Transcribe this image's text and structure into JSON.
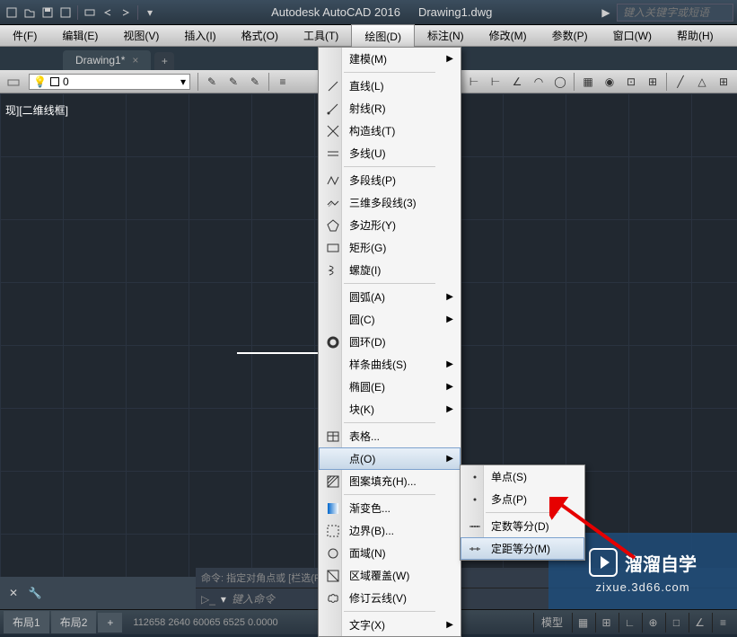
{
  "title": {
    "app": "Autodesk AutoCAD 2016",
    "file": "Drawing1.dwg"
  },
  "search": {
    "placeholder": "键入关键字或短语"
  },
  "menus": [
    "件(F)",
    "编辑(E)",
    "视图(V)",
    "插入(I)",
    "格式(O)",
    "工具(T)",
    "绘图(D)",
    "标注(N)",
    "修改(M)",
    "参数(P)",
    "窗口(W)",
    "帮助(H)"
  ],
  "active_menu_index": 6,
  "file_tab": {
    "name": "Drawing1*"
  },
  "layer": {
    "name": "0"
  },
  "canvas": {
    "label": "现][二维线框]"
  },
  "cmd": {
    "history": "命令: 指定对角点或 [栏选(F)/圈围(WP)/圈交(CP)]:",
    "prompt": "键入命令"
  },
  "layouts": [
    "布局1",
    "布局2"
  ],
  "coords": "112658 2640 60065 6525 0.0000",
  "status_label": "模型",
  "dropdown_items": [
    {
      "label": "建模(M)",
      "submenu": true
    },
    {
      "sep": true
    },
    {
      "label": "直线(L)"
    },
    {
      "label": "射线(R)"
    },
    {
      "label": "构造线(T)"
    },
    {
      "label": "多线(U)"
    },
    {
      "sep": true
    },
    {
      "label": "多段线(P)"
    },
    {
      "label": "三维多段线(3)"
    },
    {
      "label": "多边形(Y)"
    },
    {
      "label": "矩形(G)"
    },
    {
      "label": "螺旋(I)"
    },
    {
      "sep": true
    },
    {
      "label": "圆弧(A)",
      "submenu": true
    },
    {
      "label": "圆(C)",
      "submenu": true
    },
    {
      "label": "圆环(D)"
    },
    {
      "label": "样条曲线(S)",
      "submenu": true
    },
    {
      "label": "椭圆(E)",
      "submenu": true
    },
    {
      "label": "块(K)",
      "submenu": true
    },
    {
      "sep": true
    },
    {
      "label": "表格...",
      "icon": "table"
    },
    {
      "label": "点(O)",
      "submenu": true,
      "hover": true
    },
    {
      "label": "图案填充(H)..."
    },
    {
      "sep": true
    },
    {
      "label": "渐变色..."
    },
    {
      "label": "边界(B)..."
    },
    {
      "label": "面域(N)"
    },
    {
      "label": "区域覆盖(W)"
    },
    {
      "label": "修订云线(V)"
    },
    {
      "sep": true
    },
    {
      "label": "文字(X)",
      "submenu": true
    }
  ],
  "submenu_items": [
    {
      "label": "单点(S)"
    },
    {
      "label": "多点(P)"
    },
    {
      "sep": true
    },
    {
      "label": "定数等分(D)"
    },
    {
      "label": "定距等分(M)",
      "highlight": true
    }
  ],
  "watermark": {
    "brand": "溜溜自学",
    "url": "zixue.3d66.com"
  }
}
